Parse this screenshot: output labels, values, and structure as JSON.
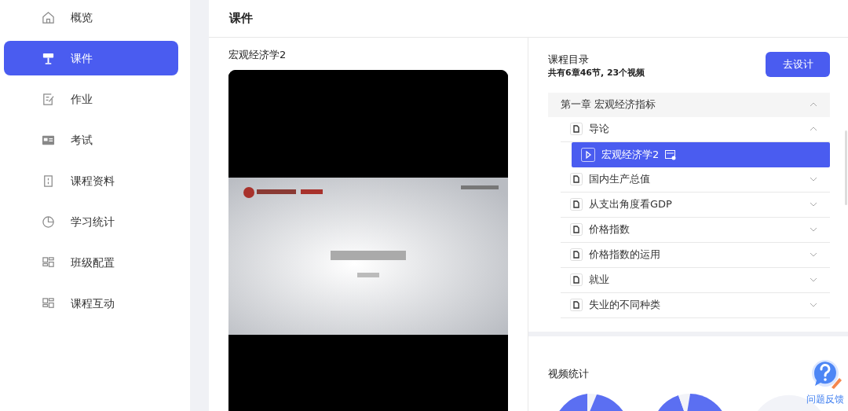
{
  "sidebar": {
    "items": [
      {
        "label": "概览",
        "selected": false
      },
      {
        "label": "课件",
        "selected": true
      },
      {
        "label": "作业",
        "selected": false
      },
      {
        "label": "考试",
        "selected": false
      },
      {
        "label": "课程资料",
        "selected": false
      },
      {
        "label": "学习统计",
        "selected": false
      },
      {
        "label": "班级配置",
        "selected": false
      },
      {
        "label": "课程互动",
        "selected": false
      }
    ]
  },
  "page": {
    "title": "课件"
  },
  "player": {
    "title": "宏观经济学2"
  },
  "catalog": {
    "title": "课程目录",
    "summary": "共有6章46节, 23个视频",
    "design_button": "去设计",
    "items": [
      {
        "label": "第一章 宏观经济指标",
        "expanded": true,
        "children": [
          {
            "label": "导论",
            "expanded": true,
            "children": [
              {
                "label": "宏观经济学2",
                "selected": true
              }
            ]
          },
          {
            "label": "国内生产总值",
            "expanded": false
          },
          {
            "label": "从支出角度看GDP",
            "expanded": false
          },
          {
            "label": "价格指数",
            "expanded": false
          },
          {
            "label": "价格指数的运用",
            "expanded": false
          },
          {
            "label": "就业",
            "expanded": false
          },
          {
            "label": "失业的不同种类",
            "expanded": false
          }
        ]
      }
    ]
  },
  "video_stats": {
    "title": "视频统计"
  },
  "feedback": {
    "label": "问题反馈"
  }
}
